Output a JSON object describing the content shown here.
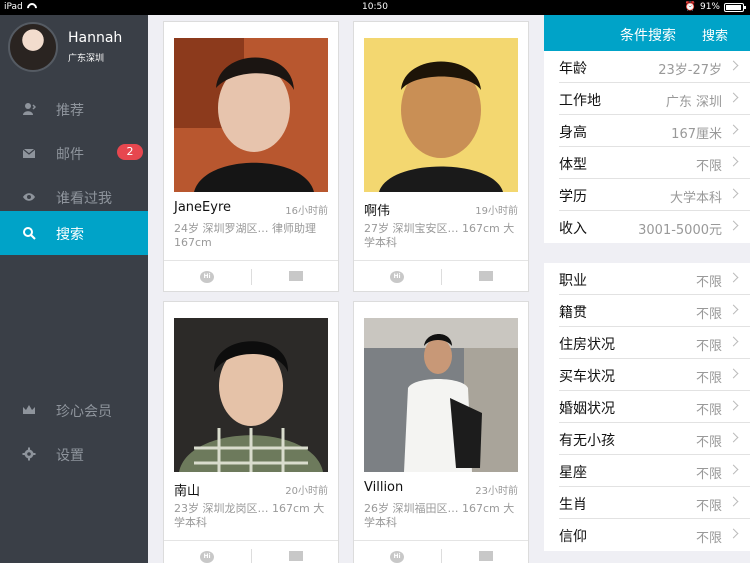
{
  "status_bar": {
    "device": "iPad",
    "time": "10:50",
    "battery": "91%",
    "battery_level": 0.91
  },
  "profile": {
    "name": "Hannah",
    "location": "广东深圳"
  },
  "sidebar": {
    "items": [
      {
        "label": "推荐",
        "icon": "recommend-icon"
      },
      {
        "label": "邮件",
        "icon": "mail-icon",
        "badge": "2"
      },
      {
        "label": "谁看过我",
        "icon": "eye-icon"
      },
      {
        "label": "搜索",
        "icon": "search-icon",
        "active": true
      }
    ],
    "bottom_items": [
      {
        "label": "珍心会员",
        "icon": "crown-icon"
      },
      {
        "label": "设置",
        "icon": "gear-icon"
      }
    ]
  },
  "feed": {
    "cards": [
      {
        "name": "JaneEyre",
        "time": "16小时前",
        "info": "24岁  深圳罗湖区…  律师助理 167cm"
      },
      {
        "name": "啊伟",
        "time": "19小时前",
        "info": "27岁  深圳宝安区…  167cm 大学本科"
      },
      {
        "name": "南山",
        "time": "20小时前",
        "info": "23岁  深圳龙岗区…  167cm 大学本科"
      },
      {
        "name": "Villion",
        "time": "23小时前",
        "info": "26岁  深圳福田区…  167cm 大学本科"
      }
    ]
  },
  "search_panel": {
    "title": "条件搜索",
    "search_button": "搜索",
    "group1": [
      {
        "label": "年龄",
        "value": "23岁-27岁"
      },
      {
        "label": "工作地",
        "value": "广东 深圳"
      },
      {
        "label": "身高",
        "value": "167厘米"
      },
      {
        "label": "体型",
        "value": "不限"
      },
      {
        "label": "学历",
        "value": "大学本科"
      },
      {
        "label": "收入",
        "value": "3001-5000元"
      }
    ],
    "group2": [
      {
        "label": "职业",
        "value": "不限"
      },
      {
        "label": "籍贯",
        "value": "不限"
      },
      {
        "label": "住房状况",
        "value": "不限"
      },
      {
        "label": "买车状况",
        "value": "不限"
      },
      {
        "label": "婚姻状况",
        "value": "不限"
      },
      {
        "label": "有无小孩",
        "value": "不限"
      },
      {
        "label": "星座",
        "value": "不限"
      },
      {
        "label": "生肖",
        "value": "不限"
      },
      {
        "label": "信仰",
        "value": "不限"
      }
    ]
  },
  "colors": {
    "accent": "#00a3c8",
    "sidebar_bg": "#3a3f47",
    "badge": "#e7474f"
  }
}
